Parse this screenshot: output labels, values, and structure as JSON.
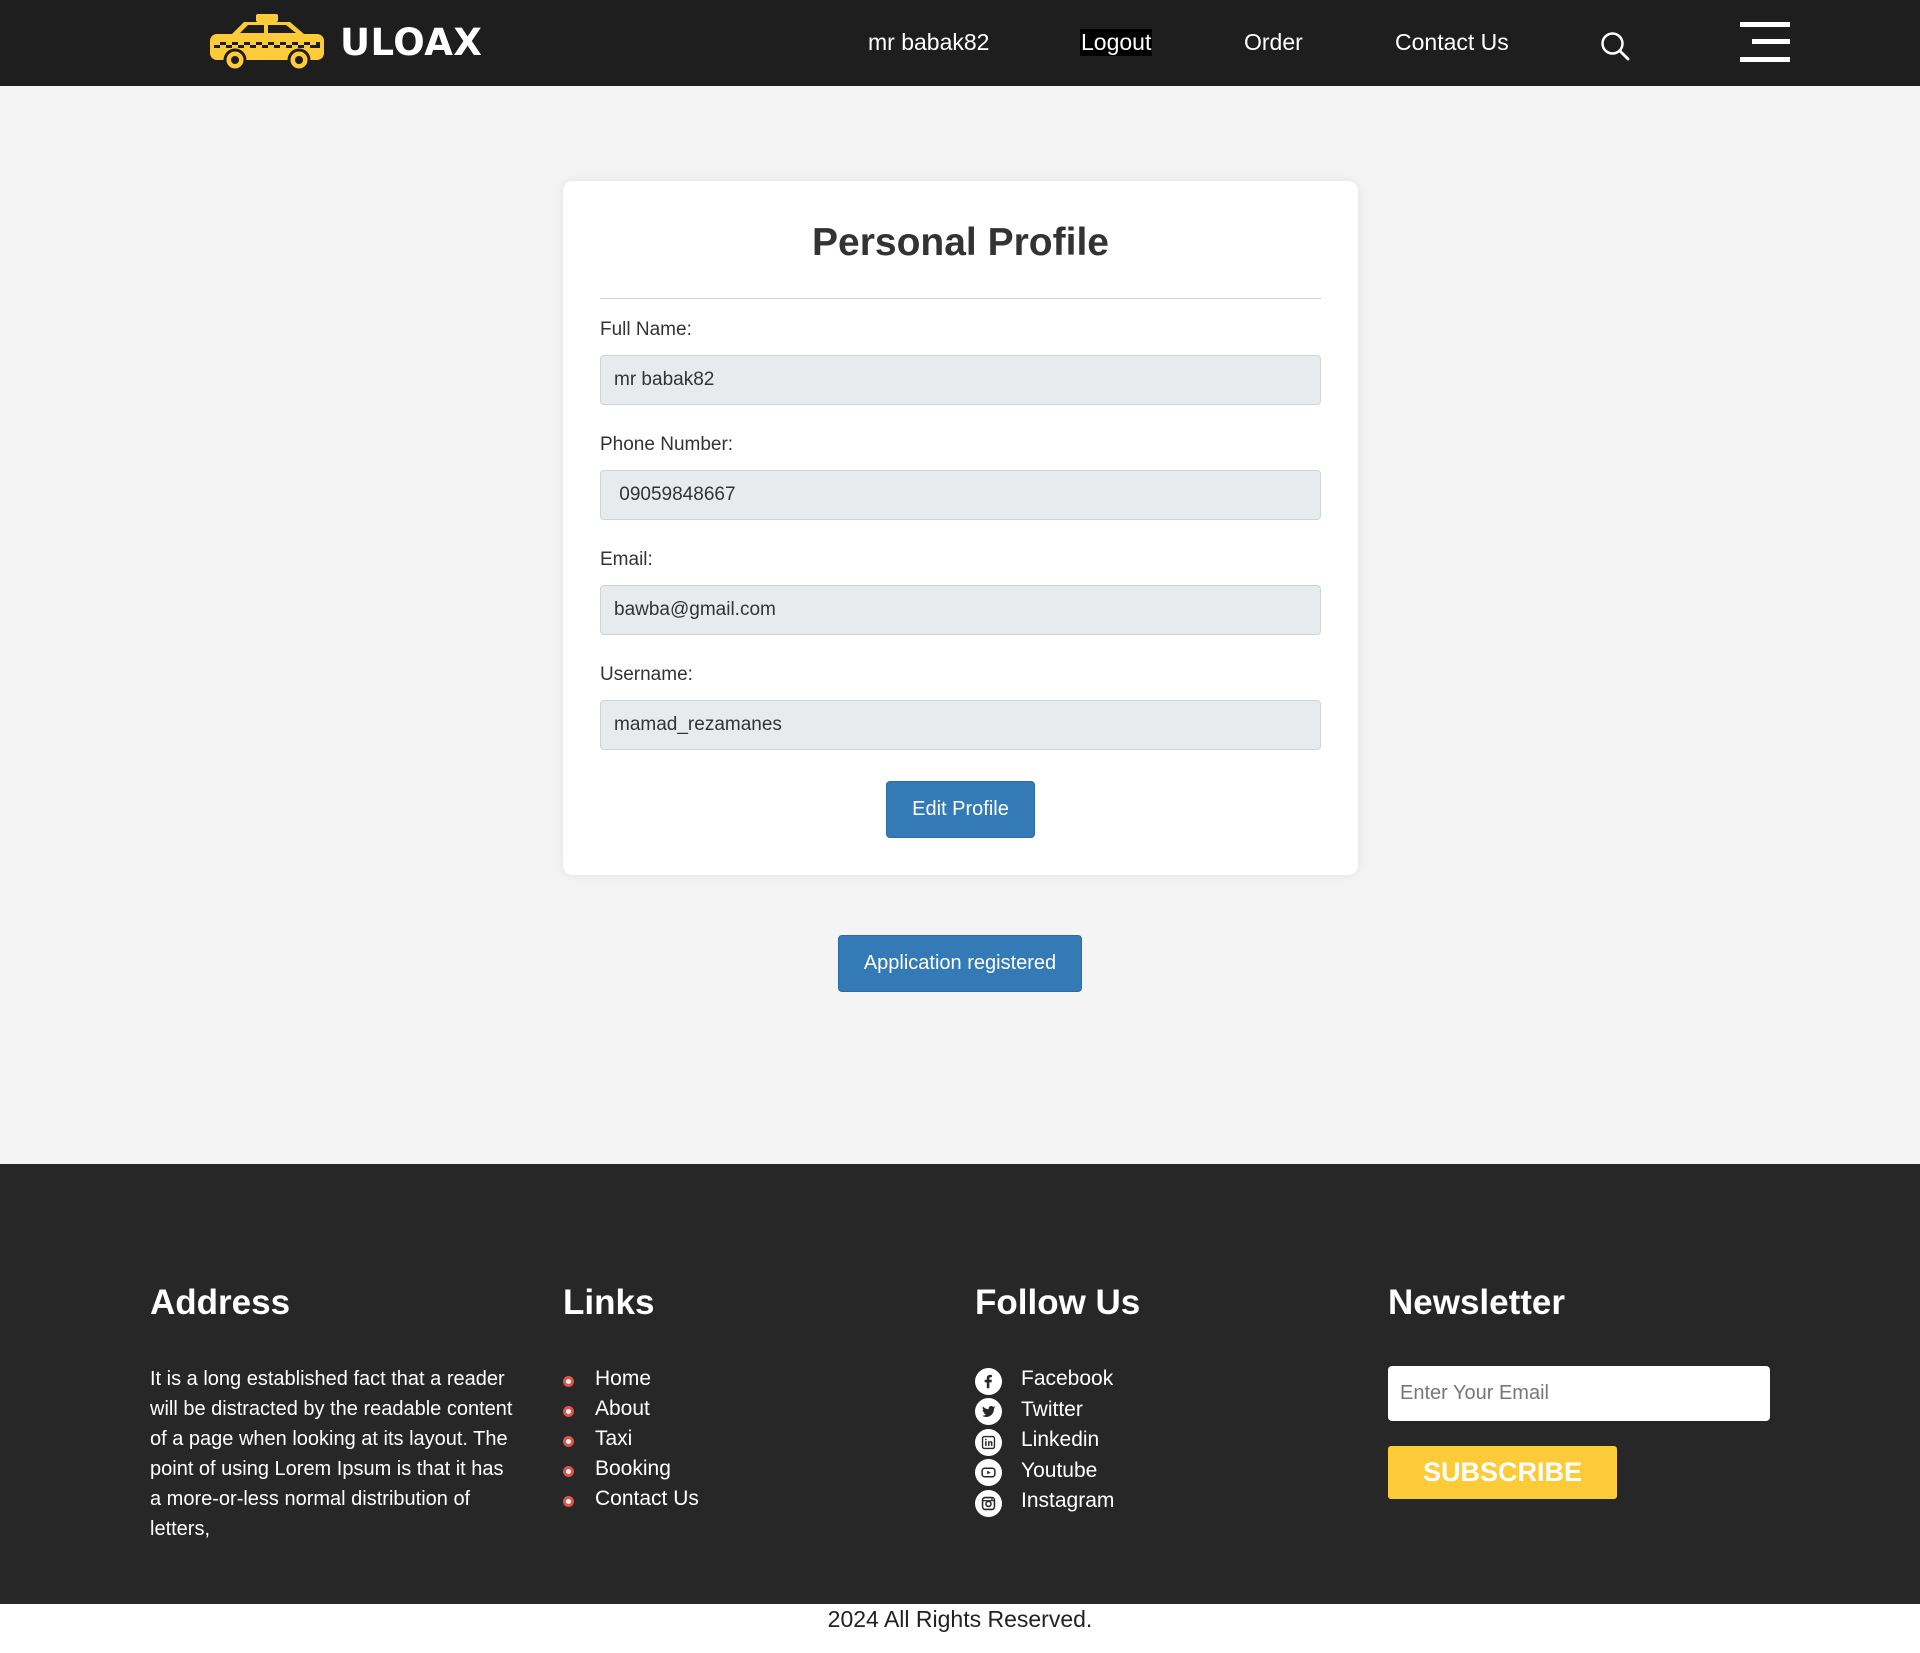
{
  "header": {
    "logo_text": "ULOAX",
    "nav": {
      "user": "mr babak82",
      "logout": "Logout",
      "order": "Order",
      "contact": "Contact Us"
    }
  },
  "profile": {
    "title": "Personal Profile",
    "full_name_label": "Full Name:",
    "full_name_value": "mr babak82",
    "phone_label": "Phone Number:",
    "phone_value": " 09059848667",
    "email_label": "Email:",
    "email_value": "bawba@gmail.com",
    "username_label": "Username:",
    "username_value": "mamad_rezamanes",
    "edit_button": "Edit Profile"
  },
  "application_button": "Application registered",
  "footer": {
    "address_heading": "Address",
    "address_text": "It is a long established fact that a reader will be distracted by the readable content of a page when looking at its layout. The point of using Lorem Ipsum is that it has a more-or-less normal distribution of letters,",
    "links_heading": "Links",
    "links": [
      "Home",
      "About",
      "Taxi",
      "Booking",
      "Contact Us"
    ],
    "follow_heading": "Follow Us",
    "social": [
      {
        "label": "Facebook",
        "icon": "facebook-icon"
      },
      {
        "label": "Twitter",
        "icon": "twitter-icon"
      },
      {
        "label": "Linkedin",
        "icon": "linkedin-icon"
      },
      {
        "label": "Youtube",
        "icon": "youtube-icon"
      },
      {
        "label": "Instagram",
        "icon": "instagram-icon"
      }
    ],
    "newsletter_heading": "Newsletter",
    "newsletter_placeholder": "Enter Your Email",
    "subscribe_button": "SUBSCRIBE"
  },
  "copyright": "2024 All Rights Reserved.",
  "colors": {
    "header_bg": "#1e1e1e",
    "primary_button": "#337ab7",
    "subscribe_button": "#fdcb37",
    "footer_bg": "#272727",
    "bullet": "#e0524a"
  }
}
